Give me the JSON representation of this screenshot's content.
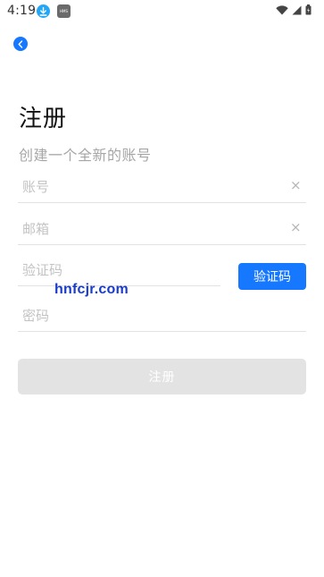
{
  "status_bar": {
    "time": "4:19",
    "download_icon": "download-icon",
    "hms_label": "HMS",
    "wifi_icon": "wifi-icon",
    "signal_icon": "signal-icon",
    "battery_icon": "battery-icon"
  },
  "header": {
    "back_icon": "chevron-left-icon",
    "title": "注册",
    "subtitle": "创建一个全新的账号"
  },
  "form": {
    "account": {
      "placeholder": "账号",
      "value": ""
    },
    "email": {
      "placeholder": "邮箱",
      "value": ""
    },
    "code": {
      "placeholder": "验证码",
      "value": ""
    },
    "get_code_label": "验证码",
    "password": {
      "placeholder": "密码",
      "value": ""
    },
    "clear_icon_glyph": "×"
  },
  "watermark": "hnfcjr.com",
  "register_button": {
    "label": "注册",
    "enabled": false
  },
  "colors": {
    "accent": "#1677ff",
    "disabled_button": "#e3e3e3",
    "placeholder": "#c3c3c3",
    "subtitle": "#a6a6a6"
  }
}
